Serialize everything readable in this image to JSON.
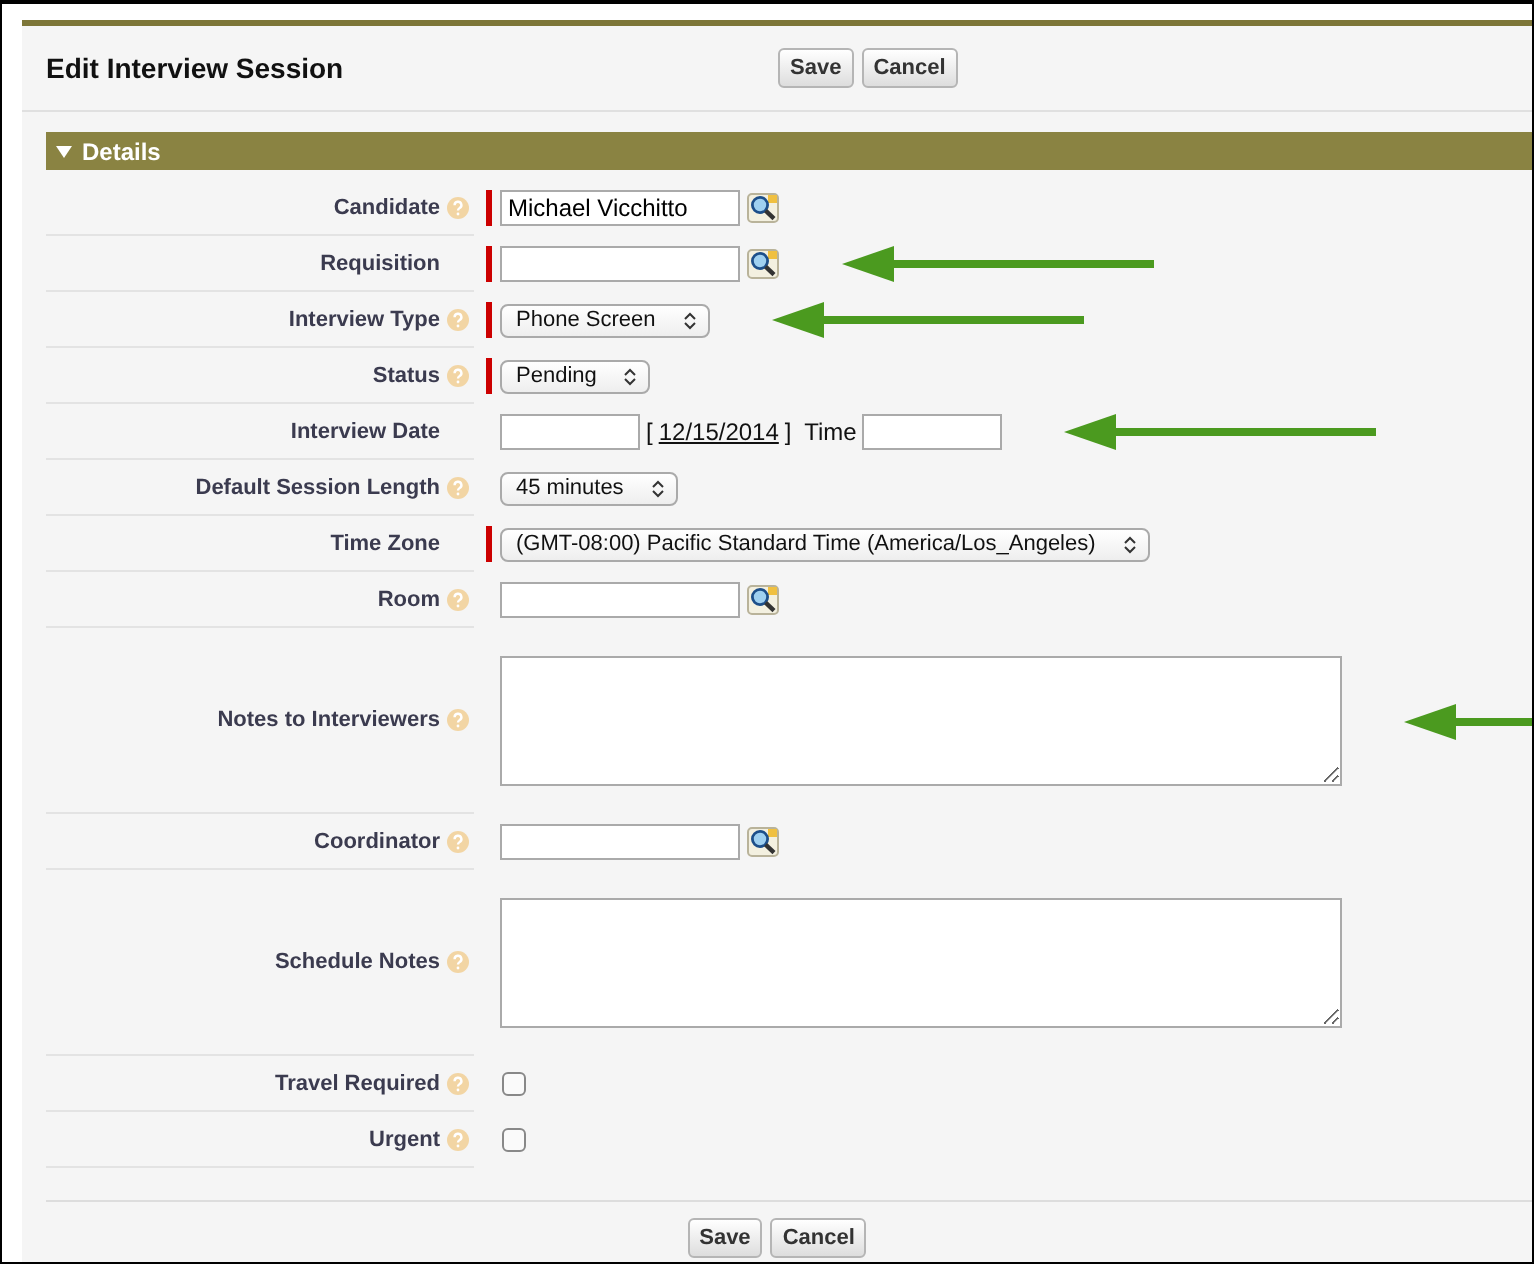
{
  "title": "Edit Interview Session",
  "header_buttons": [
    "Save",
    "Cancel"
  ],
  "section": {
    "title": "Details",
    "expanded": true
  },
  "rows": [
    {
      "kind": "lookup",
      "label": "Candidate",
      "help": true,
      "required": true,
      "value": "Michael Vicchitto",
      "annotated": false
    },
    {
      "kind": "lookup",
      "label": "Requisition",
      "help": false,
      "required": true,
      "annotated": true
    },
    {
      "kind": "select",
      "label": "Interview Type",
      "help": true,
      "required": true,
      "value": "Phone Screen",
      "annotated": true
    },
    {
      "kind": "select",
      "label": "Status",
      "help": true,
      "required": true,
      "value": "Pending",
      "annotated": false
    },
    {
      "kind": "date",
      "label": "Interview Date",
      "help": false,
      "required": false,
      "bracket_open": "[",
      "date_link": "12/15/2014",
      "bracket_close": "]",
      "time_label": "Time",
      "annotated": true
    },
    {
      "kind": "select",
      "label": "Default Session Length",
      "help": true,
      "required": false,
      "value": "45 minutes",
      "annotated": false
    },
    {
      "kind": "select",
      "label": "Time Zone",
      "help": false,
      "required": true,
      "value": "(GMT-08:00) Pacific Standard Time (America/Los_Angeles)",
      "annotated": false
    },
    {
      "kind": "lookup",
      "label": "Room",
      "help": true,
      "required": false,
      "annotated": false
    },
    {
      "kind": "textarea",
      "label": "Notes to Interviewers",
      "help": true,
      "required": false,
      "annotated": true
    },
    {
      "kind": "lookup",
      "label": "Coordinator",
      "help": true,
      "required": false,
      "annotated": false
    },
    {
      "kind": "textarea",
      "label": "Schedule Notes",
      "help": true,
      "required": false,
      "annotated": false
    },
    {
      "kind": "checkbox",
      "label": "Travel Required",
      "help": true,
      "required": false,
      "checked": false,
      "annotated": false
    },
    {
      "kind": "checkbox",
      "label": "Urgent",
      "help": true,
      "required": false,
      "checked": false,
      "annotated": false
    }
  ],
  "footer_buttons": [
    "Save",
    "Cancel"
  ]
}
